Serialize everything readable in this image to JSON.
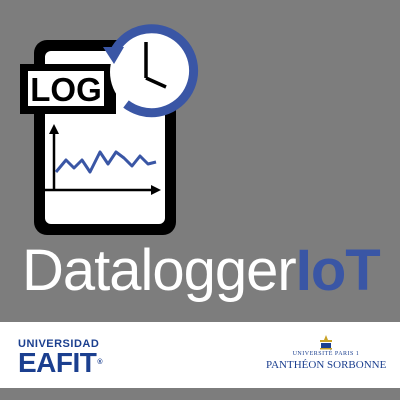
{
  "icon": {
    "log_label": "LOG",
    "document": "document-icon",
    "clock": "clock-icon",
    "chart": "line-chart-icon",
    "accent_color": "#3a56a5"
  },
  "title": {
    "part1": "Datalogger",
    "part2": "IoT"
  },
  "logos": {
    "eafit_line1": "UNIVERSIDAD",
    "eafit_line2": "EAFIT",
    "eafit_reg": "®",
    "sorbonne_line1": "UNIVERSITÉ PARIS 1",
    "sorbonne_line2": "PANTHÉON SORBONNE"
  },
  "colors": {
    "background": "#7d7d7d",
    "brand_blue": "#3a56a5",
    "logo_blue": "#1b3f8f"
  }
}
